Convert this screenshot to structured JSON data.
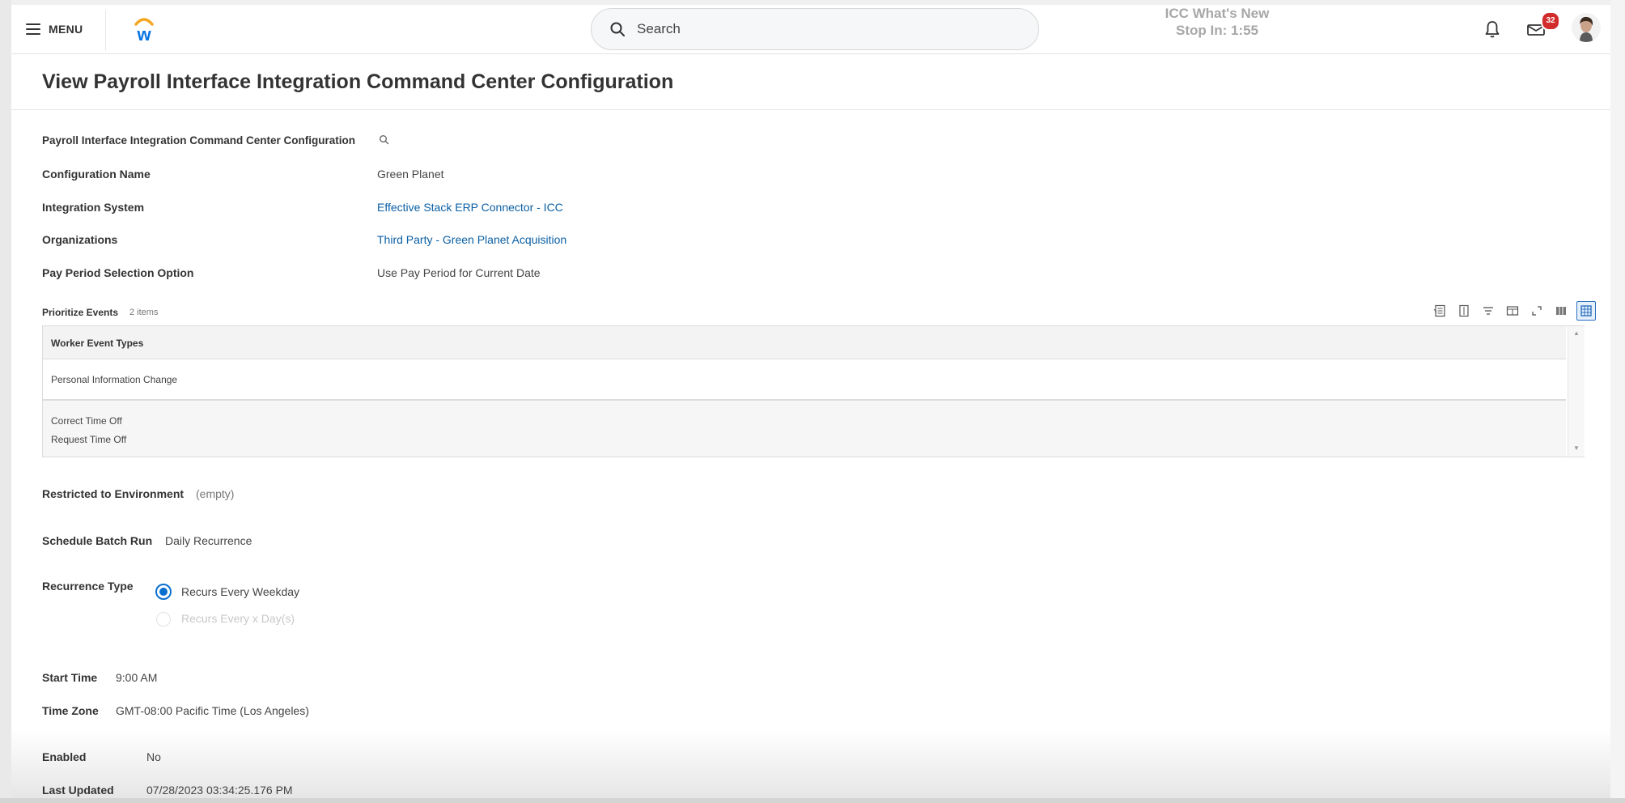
{
  "header": {
    "menu_label": "MENU",
    "logo_letter": "w",
    "search_placeholder": "Search",
    "banner_line1": "ICC What's New",
    "banner_line2": "Stop In: 1:55",
    "inbox_count": "32"
  },
  "page": {
    "title": "View Payroll Interface Integration Command Center Configuration"
  },
  "fields": {
    "config_lookup_label": "Payroll Interface Integration Command Center Configuration",
    "config_name_label": "Configuration Name",
    "config_name_value": "Green Planet",
    "integration_system_label": "Integration System",
    "integration_system_value": "Effective Stack ERP Connector - ICC",
    "organizations_label": "Organizations",
    "organizations_value": "Third Party - Green Planet Acquisition",
    "pay_period_label": "Pay Period Selection Option",
    "pay_period_value": "Use Pay Period for Current Date"
  },
  "prioritize_events": {
    "label": "Prioritize Events",
    "count": "2 items",
    "column_header": "Worker Event Types",
    "rows": [
      [
        "Personal Information Change"
      ],
      [
        "Correct Time Off",
        "Request Time Off"
      ]
    ]
  },
  "settings": {
    "restricted_label": "Restricted to Environment",
    "restricted_value": "(empty)",
    "schedule_label": "Schedule Batch Run",
    "schedule_value": "Daily Recurrence",
    "recurrence_label": "Recurrence Type",
    "recurrence_options": [
      "Recurs Every Weekday",
      "Recurs Every x Day(s)"
    ],
    "recurrence_selected": "Recurs Every Weekday",
    "start_time_label": "Start Time",
    "start_time_value": "9:00 AM",
    "time_zone_label": "Time Zone",
    "time_zone_value": "GMT-08:00 Pacific Time (Los Angeles)",
    "enabled_label": "Enabled",
    "enabled_value": "No",
    "last_updated_label": "Last Updated",
    "last_updated_value": "07/28/2023 03:34:25.176 PM"
  },
  "colors": {
    "link": "#0b5fa5",
    "radio_selected": "#0b6fd0",
    "badge": "#d12b2b",
    "logo_orange": "#f5a623",
    "logo_blue": "#0875e1"
  }
}
